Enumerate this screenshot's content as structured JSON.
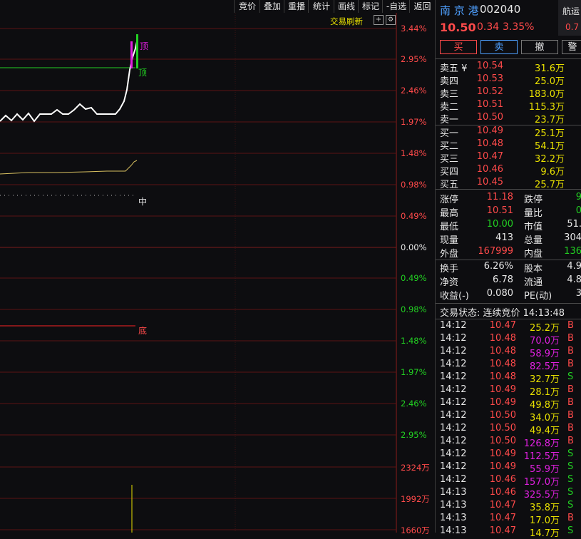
{
  "toolbar": [
    "竞价",
    "叠加",
    "重播",
    "统计",
    "画线",
    "标记",
    "-自选",
    "返回"
  ],
  "chart": {
    "refresh_label": "交易刷新",
    "y_labels": [
      {
        "text": "3.44%",
        "color": "#ff4a4a"
      },
      {
        "text": "2.95%",
        "color": "#ff4a4a"
      },
      {
        "text": "2.46%",
        "color": "#ff4a4a"
      },
      {
        "text": "1.97%",
        "color": "#ff4a4a"
      },
      {
        "text": "1.48%",
        "color": "#ff4a4a"
      },
      {
        "text": "0.98%",
        "color": "#ff4a4a"
      },
      {
        "text": "0.49%",
        "color": "#ff4a4a"
      },
      {
        "text": "0.00%",
        "color": "#e6e6e6"
      },
      {
        "text": "0.49%",
        "color": "#22d022"
      },
      {
        "text": "0.98%",
        "color": "#22d022"
      },
      {
        "text": "1.48%",
        "color": "#22d022"
      },
      {
        "text": "1.97%",
        "color": "#22d022"
      },
      {
        "text": "2.46%",
        "color": "#22d022"
      },
      {
        "text": "2.95%",
        "color": "#22d022"
      },
      {
        "text": "2324万",
        "color": "#ff4a4a"
      },
      {
        "text": "1992万",
        "color": "#ff4a4a"
      },
      {
        "text": "1660万",
        "color": "#ff4a4a"
      }
    ],
    "marker_top": "顶",
    "marker_top2": "顶",
    "marker_mid": "中",
    "marker_bottom": "底"
  },
  "stock": {
    "name": "南 京 港",
    "code": "002040",
    "price": "10.50",
    "change": "0.34",
    "pct": "3.35%",
    "tag": "航运",
    "tag_value": "0.7"
  },
  "buttons": [
    "买",
    "卖",
    "撤",
    "警"
  ],
  "asks": [
    {
      "label": "卖五 ¥",
      "price": "10.54",
      "vol": "31.6万"
    },
    {
      "label": "卖四",
      "price": "10.53",
      "vol": "25.0万"
    },
    {
      "label": "卖三",
      "price": "10.52",
      "vol": "183.0万"
    },
    {
      "label": "卖二",
      "price": "10.51",
      "vol": "115.3万"
    },
    {
      "label": "卖一",
      "price": "10.50",
      "vol": "23.7万"
    }
  ],
  "bids": [
    {
      "label": "买一",
      "price": "10.49",
      "vol": "25.1万"
    },
    {
      "label": "买二",
      "price": "10.48",
      "vol": "54.1万"
    },
    {
      "label": "买三",
      "price": "10.47",
      "vol": "32.2万"
    },
    {
      "label": "买四",
      "price": "10.46",
      "vol": "9.6万"
    },
    {
      "label": "买五",
      "price": "10.45",
      "vol": "25.7万"
    }
  ],
  "stats1": [
    {
      "l1": "涨停",
      "v1": "11.18",
      "c1": "red",
      "l2": "跌停",
      "v2": "9"
    },
    {
      "l1": "最高",
      "v1": "10.51",
      "c1": "red",
      "l2": "量比",
      "v2": "0"
    },
    {
      "l1": "最低",
      "v1": "10.00",
      "c1": "green",
      "l2": "市值",
      "v2": "51."
    },
    {
      "l1": "现量",
      "v1": "413",
      "c1": "white",
      "l2": "总量",
      "v2": "304"
    },
    {
      "l1": "外盘",
      "v1": "167999",
      "c1": "red",
      "l2": "内盘",
      "v2": "136"
    }
  ],
  "stats2": [
    {
      "l1": "换手",
      "v1": "6.26%",
      "l2": "股本",
      "v2": "4.9"
    },
    {
      "l1": "净资",
      "v1": "6.78",
      "l2": "流通",
      "v2": "4.8"
    },
    {
      "l1": "收益(-)",
      "v1": "0.080",
      "l2": "PE(动)",
      "v2": "3"
    }
  ],
  "trade_status": "交易状态: 连续竞价  14:13:48",
  "ticks": [
    {
      "t": "14:12",
      "p": "10.47",
      "v": "25.2万",
      "s": "B",
      "vc": "yellow"
    },
    {
      "t": "14:12",
      "p": "10.48",
      "v": "70.0万",
      "s": "B",
      "vc": "magenta"
    },
    {
      "t": "14:12",
      "p": "10.48",
      "v": "58.9万",
      "s": "B",
      "vc": "magenta"
    },
    {
      "t": "14:12",
      "p": "10.48",
      "v": "82.5万",
      "s": "B",
      "vc": "magenta"
    },
    {
      "t": "14:12",
      "p": "10.48",
      "v": "32.7万",
      "s": "S",
      "vc": "yellow"
    },
    {
      "t": "14:12",
      "p": "10.49",
      "v": "28.1万",
      "s": "B",
      "vc": "yellow"
    },
    {
      "t": "14:12",
      "p": "10.49",
      "v": "49.8万",
      "s": "B",
      "vc": "yellow"
    },
    {
      "t": "14:12",
      "p": "10.50",
      "v": "34.0万",
      "s": "B",
      "vc": "yellow"
    },
    {
      "t": "14:12",
      "p": "10.50",
      "v": "49.4万",
      "s": "B",
      "vc": "yellow"
    },
    {
      "t": "14:12",
      "p": "10.50",
      "v": "126.8万",
      "s": "B",
      "vc": "magenta"
    },
    {
      "t": "14:12",
      "p": "10.49",
      "v": "112.5万",
      "s": "S",
      "vc": "magenta"
    },
    {
      "t": "14:12",
      "p": "10.49",
      "v": "55.9万",
      "s": "S",
      "vc": "magenta"
    },
    {
      "t": "14:12",
      "p": "10.46",
      "v": "157.0万",
      "s": "S",
      "vc": "magenta"
    },
    {
      "t": "14:13",
      "p": "10.46",
      "v": "325.5万",
      "s": "S",
      "vc": "magenta"
    },
    {
      "t": "14:13",
      "p": "10.47",
      "v": "35.8万",
      "s": "S",
      "vc": "yellow"
    },
    {
      "t": "14:13",
      "p": "10.47",
      "v": "17.0万",
      "s": "B",
      "vc": "yellow"
    },
    {
      "t": "14:13",
      "p": "10.47",
      "v": "14.7万",
      "s": "S",
      "vc": "yellow"
    }
  ]
}
